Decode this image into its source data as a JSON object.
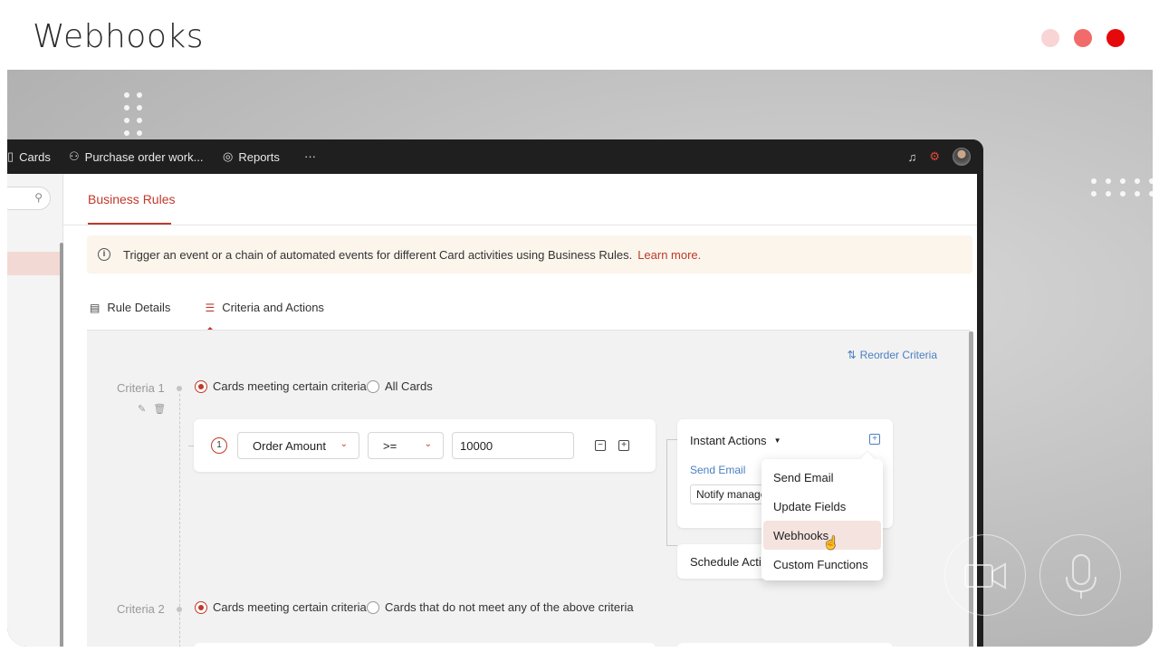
{
  "slide": {
    "title": "Webhooks",
    "dot_colors": [
      "#f8d4d4",
      "#f26b6b",
      "#e5090b"
    ]
  },
  "topbar": {
    "items": [
      {
        "label": "Cards",
        "icon": "cards-icon"
      },
      {
        "label": "Purchase order work...",
        "icon": "workflow-icon"
      },
      {
        "label": "Reports",
        "icon": "reports-icon"
      },
      {
        "label": "···",
        "icon": "more-icon"
      }
    ]
  },
  "page": {
    "heading": "Business Rules",
    "banner_text": "Trigger an event or a chain of automated events for different Card activities using Business Rules.",
    "banner_link": "Learn more.",
    "tabs": [
      {
        "label": "Rule Details"
      },
      {
        "label": "Criteria and Actions"
      }
    ],
    "reorder_label": "Reorder Criteria"
  },
  "criteria1": {
    "label": "Criteria 1",
    "option_a": "Cards meeting certain criteria",
    "option_b": "All Cards",
    "condition": {
      "index": "1",
      "field": "Order Amount",
      "operator": ">=",
      "value": "10000"
    }
  },
  "actions": {
    "instant_title": "Instant Actions",
    "send_email_link": "Send Email",
    "notify_chip": "Notify manager",
    "schedule_title": "Schedule Action",
    "menu": [
      {
        "label": "Send Email"
      },
      {
        "label": "Update Fields"
      },
      {
        "label": "Webhooks"
      },
      {
        "label": "Custom Functions"
      }
    ]
  },
  "criteria2": {
    "label": "Criteria 2",
    "option_a": "Cards meeting certain criteria",
    "option_b": "Cards that do not meet any of the above criteria"
  }
}
